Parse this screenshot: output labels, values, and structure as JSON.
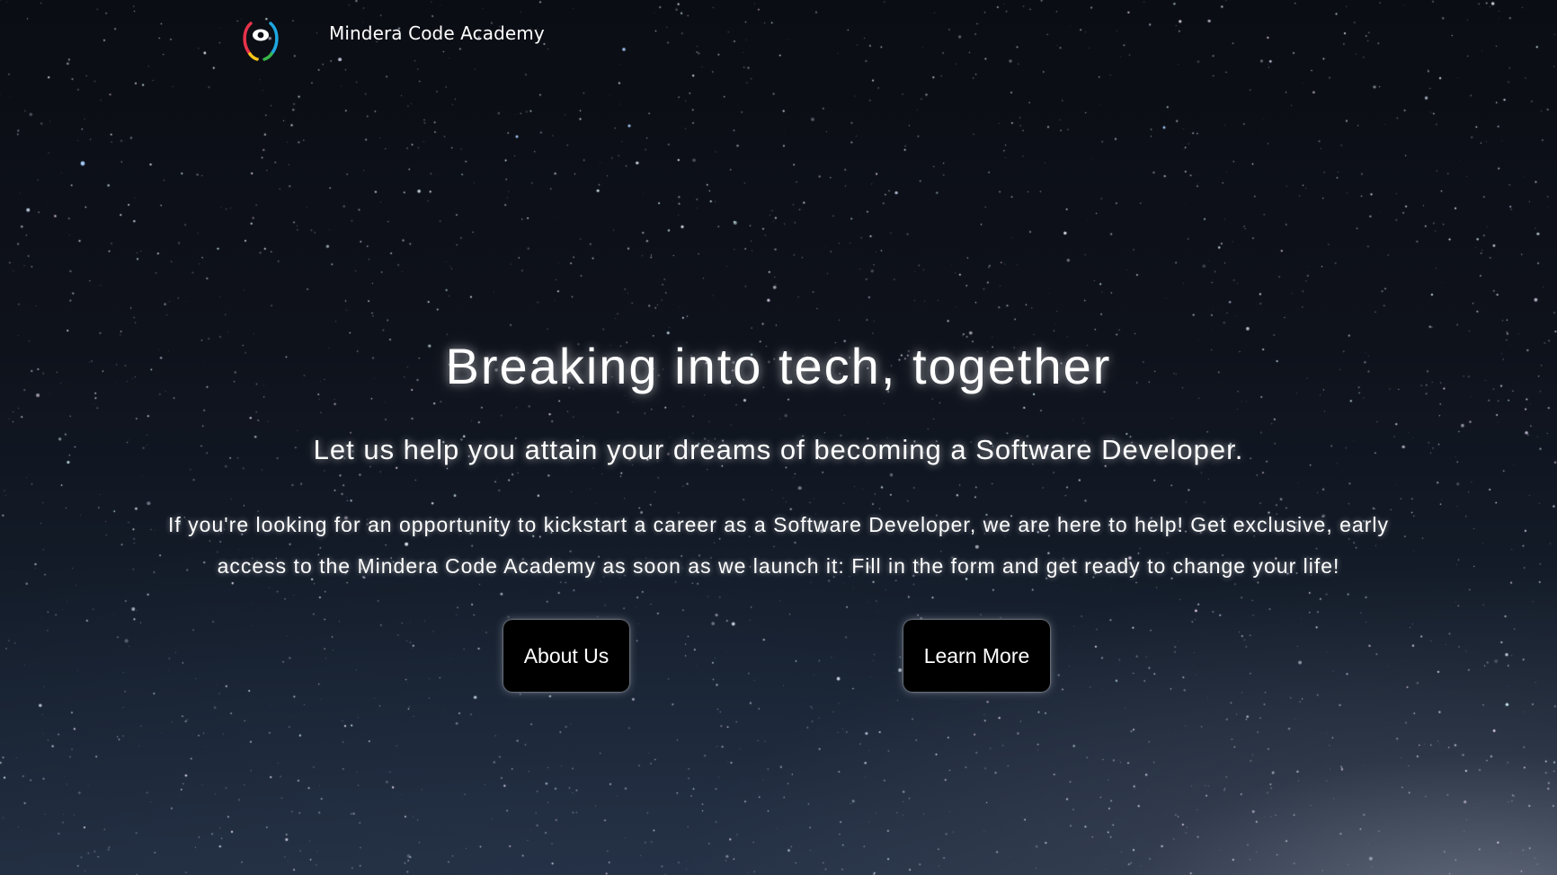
{
  "nav": {
    "brand": "Mindera Code Academy",
    "logo_icon": "mindera-eye-logo-icon"
  },
  "hero": {
    "headline": "Breaking into tech, together",
    "subheadline": "Let us help you attain your dreams of becoming a Software Developer.",
    "body_line_1": "If you're looking for an opportunity to kickstart a career as a Software Developer, we are here to help! Get exclusive, early",
    "body_line_2": "access to the Mindera Code Academy as soon as we launch it: Fill in the form and get ready to change your life!"
  },
  "buttons": {
    "about_label": "About Us",
    "learn_label": "Learn More"
  },
  "colors": {
    "text": "#ffffff",
    "button_bg": "#000000",
    "sky_top": "#0b0d14",
    "sky_bottom": "#1f2a3b",
    "logo_red": "#e8334a",
    "logo_yellow": "#f5c518",
    "logo_green": "#39b54a",
    "logo_blue": "#1ea7e1"
  }
}
